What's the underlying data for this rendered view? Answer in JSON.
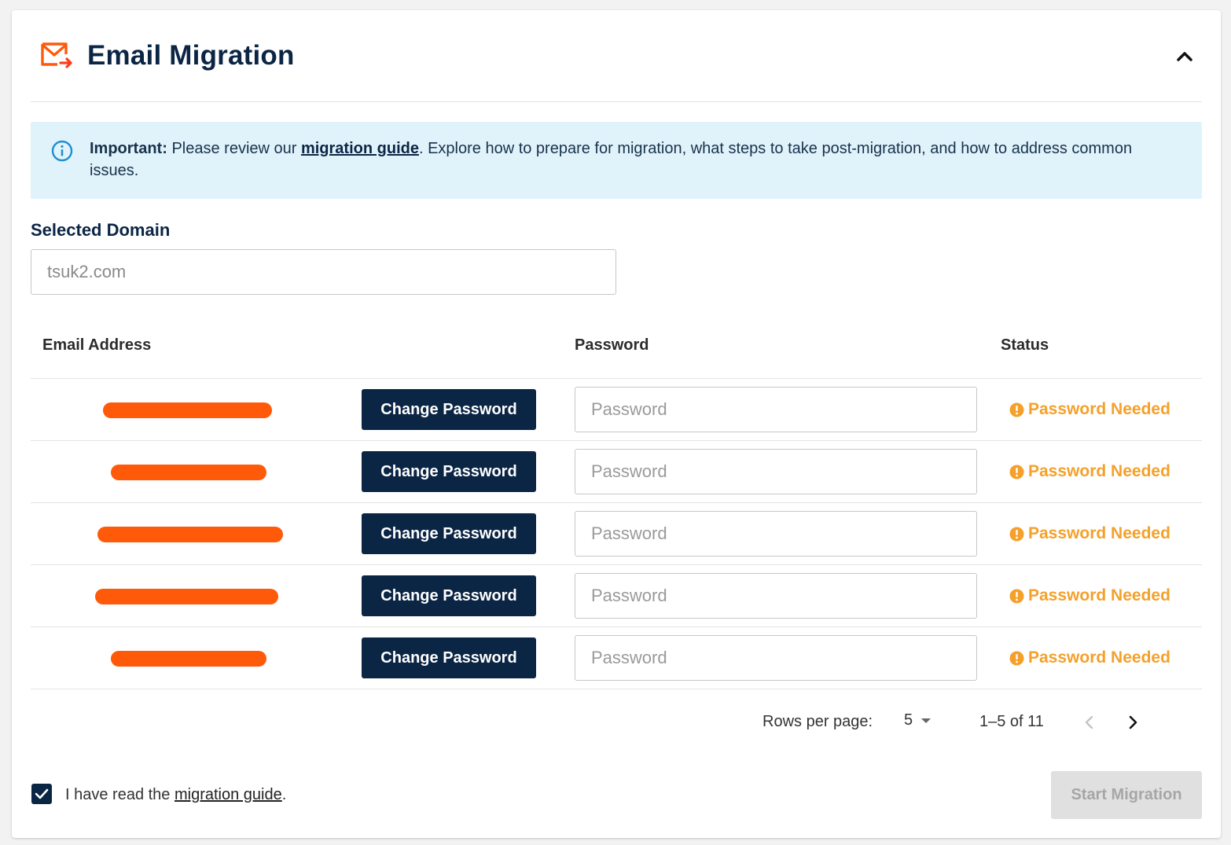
{
  "header": {
    "title": "Email Migration",
    "icon": "mail-forward-icon",
    "collapse_icon": "chevron-up-icon"
  },
  "info": {
    "icon": "info-icon",
    "bold": "Important:",
    "pre": " Please review our ",
    "link": "migration guide",
    "post": ". Explore how to prepare for migration, what steps to take post-migration, and how to address common issues."
  },
  "domain": {
    "label": "Selected Domain",
    "value": "tsuk2.com"
  },
  "table": {
    "columns": {
      "email": "Email Address",
      "password": "Password",
      "status": "Status"
    },
    "rows": [
      {
        "change_label": "Change Password",
        "password_placeholder": "Password",
        "status": "Password Needed"
      },
      {
        "change_label": "Change Password",
        "password_placeholder": "Password",
        "status": "Password Needed"
      },
      {
        "change_label": "Change Password",
        "password_placeholder": "Password",
        "status": "Password Needed"
      },
      {
        "change_label": "Change Password",
        "password_placeholder": "Password",
        "status": "Password Needed"
      },
      {
        "change_label": "Change Password",
        "password_placeholder": "Password",
        "status": "Password Needed"
      }
    ]
  },
  "pagination": {
    "rows_per_page_label": "Rows per page:",
    "rows_per_page_value": "5",
    "range": "1–5 of 11"
  },
  "footer": {
    "checkbox_checked": true,
    "check_pre": "I have read the ",
    "check_link": "migration guide",
    "check_post": ".",
    "start_button": "Start Migration"
  },
  "colors": {
    "primary": "#0b2545",
    "accent": "#ff5a0a",
    "warning": "#f5a02a",
    "info_bg": "#e1f3fa"
  }
}
